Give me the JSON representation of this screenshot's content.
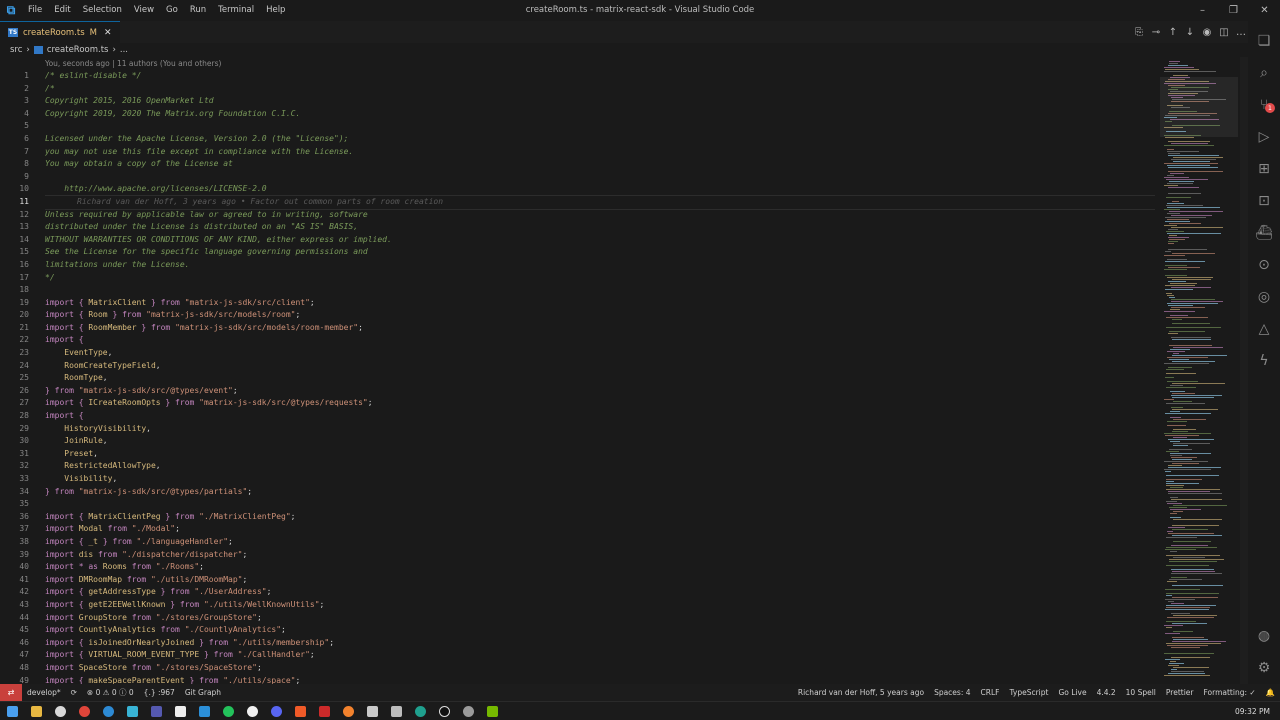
{
  "window": {
    "title": "createRoom.ts - matrix-react-sdk - Visual Studio Code",
    "menu": [
      "File",
      "Edit",
      "Selection",
      "View",
      "Go",
      "Run",
      "Terminal",
      "Help"
    ]
  },
  "tab": {
    "name": "createRoom.ts",
    "modified_marker": "M"
  },
  "breadcrumb": {
    "folder": "src",
    "file": "createRoom.ts",
    "tail": "..."
  },
  "codelens": "You, seconds ago | 11 authors (You and others)",
  "inline_blame": "Richard van der Hoff, 3 years ago • Factor out common parts of room creation",
  "code_lines": [
    {
      "n": "1",
      "t": "c",
      "s": "/* eslint-disable */"
    },
    {
      "n": "2",
      "t": "c",
      "s": "/*"
    },
    {
      "n": "3",
      "t": "c",
      "s": "Copyright 2015, 2016 OpenMarket Ltd"
    },
    {
      "n": "4",
      "t": "c",
      "s": "Copyright 2019, 2020 The Matrix.org Foundation C.I.C."
    },
    {
      "n": "5",
      "t": "c",
      "s": ""
    },
    {
      "n": "6",
      "t": "c",
      "s": "Licensed under the Apache License, Version 2.0 (the \"License\");"
    },
    {
      "n": "7",
      "t": "c",
      "s": "you may not use this file except in compliance with the License."
    },
    {
      "n": "8",
      "t": "c",
      "s": "You may obtain a copy of the License at"
    },
    {
      "n": "9",
      "t": "c",
      "s": ""
    },
    {
      "n": "10",
      "t": "c",
      "s": "    http://www.apache.org/licenses/LICENSE-2.0"
    },
    {
      "n": "11",
      "t": "b",
      "s": ""
    },
    {
      "n": "12",
      "t": "c",
      "s": "Unless required by applicable law or agreed to in writing, software"
    },
    {
      "n": "13",
      "t": "c",
      "s": "distributed under the License is distributed on an \"AS IS\" BASIS,"
    },
    {
      "n": "14",
      "t": "c",
      "s": "WITHOUT WARRANTIES OR CONDITIONS OF ANY KIND, either express or implied."
    },
    {
      "n": "15",
      "t": "c",
      "s": "See the License for the specific language governing permissions and"
    },
    {
      "n": "16",
      "t": "c",
      "s": "limitations under the License."
    },
    {
      "n": "17",
      "t": "c",
      "s": "*/"
    },
    {
      "n": "18",
      "t": "p",
      "s": ""
    },
    {
      "n": "19",
      "t": "i",
      "a": "import { ",
      "b": "MatrixClient",
      "c": " } from ",
      "d": "\"matrix-js-sdk/src/client\"",
      "e": ";"
    },
    {
      "n": "20",
      "t": "i",
      "a": "import { ",
      "b": "Room",
      "c": " } from ",
      "d": "\"matrix-js-sdk/src/models/room\"",
      "e": ";"
    },
    {
      "n": "21",
      "t": "i",
      "a": "import { ",
      "b": "RoomMember",
      "c": " } from ",
      "d": "\"matrix-js-sdk/src/models/room-member\"",
      "e": ";"
    },
    {
      "n": "22",
      "t": "i",
      "a": "import {",
      "b": "",
      "c": "",
      "d": "",
      "e": ""
    },
    {
      "n": "23",
      "t": "i",
      "a": "    ",
      "b": "EventType",
      "c": ",",
      "d": "",
      "e": ""
    },
    {
      "n": "24",
      "t": "i",
      "a": "    ",
      "b": "RoomCreateTypeField",
      "c": ",",
      "d": "",
      "e": ""
    },
    {
      "n": "25",
      "t": "i",
      "a": "    ",
      "b": "RoomType",
      "c": ",",
      "d": "",
      "e": ""
    },
    {
      "n": "26",
      "t": "i",
      "a": "} from ",
      "b": "",
      "c": "",
      "d": "\"matrix-js-sdk/src/@types/event\"",
      "e": ";"
    },
    {
      "n": "27",
      "t": "i",
      "a": "import { ",
      "b": "ICreateRoomOpts",
      "c": " } from ",
      "d": "\"matrix-js-sdk/src/@types/requests\"",
      "e": ";"
    },
    {
      "n": "28",
      "t": "i",
      "a": "import {",
      "b": "",
      "c": "",
      "d": "",
      "e": ""
    },
    {
      "n": "29",
      "t": "i",
      "a": "    ",
      "b": "HistoryVisibility",
      "c": ",",
      "d": "",
      "e": ""
    },
    {
      "n": "30",
      "t": "i",
      "a": "    ",
      "b": "JoinRule",
      "c": ",",
      "d": "",
      "e": ""
    },
    {
      "n": "31",
      "t": "i",
      "a": "    ",
      "b": "Preset",
      "c": ",",
      "d": "",
      "e": ""
    },
    {
      "n": "32",
      "t": "i",
      "a": "    ",
      "b": "RestrictedAllowType",
      "c": ",",
      "d": "",
      "e": ""
    },
    {
      "n": "33",
      "t": "i",
      "a": "    ",
      "b": "Visibility",
      "c": ",",
      "d": "",
      "e": ""
    },
    {
      "n": "34",
      "t": "i",
      "a": "} from ",
      "b": "",
      "c": "",
      "d": "\"matrix-js-sdk/src/@types/partials\"",
      "e": ";"
    },
    {
      "n": "35",
      "t": "p",
      "s": ""
    },
    {
      "n": "36",
      "t": "i",
      "a": "import { ",
      "b": "MatrixClientPeg",
      "c": " } from ",
      "d": "\"./MatrixClientPeg\"",
      "e": ";"
    },
    {
      "n": "37",
      "t": "i",
      "a": "import ",
      "b": "Modal",
      "c": " from ",
      "d": "\"./Modal\"",
      "e": ";"
    },
    {
      "n": "38",
      "t": "i",
      "a": "import { ",
      "b": "_t",
      "c": " } from ",
      "d": "\"./languageHandler\"",
      "e": ";"
    },
    {
      "n": "39",
      "t": "i",
      "a": "import ",
      "b": "dis",
      "c": " from ",
      "d": "\"./dispatcher/dispatcher\"",
      "e": ";"
    },
    {
      "n": "40",
      "t": "i",
      "a": "import * as ",
      "b": "Rooms",
      "c": " from ",
      "d": "\"./Rooms\"",
      "e": ";"
    },
    {
      "n": "41",
      "t": "i",
      "a": "import ",
      "b": "DMRoomMap",
      "c": " from ",
      "d": "\"./utils/DMRoomMap\"",
      "e": ";"
    },
    {
      "n": "42",
      "t": "i",
      "a": "import { ",
      "b": "getAddressType",
      "c": " } from ",
      "d": "\"./UserAddress\"",
      "e": ";"
    },
    {
      "n": "43",
      "t": "i",
      "a": "import { ",
      "b": "getE2EEWellKnown",
      "c": " } from ",
      "d": "\"./utils/WellKnownUtils\"",
      "e": ";"
    },
    {
      "n": "44",
      "t": "i",
      "a": "import ",
      "b": "GroupStore",
      "c": " from ",
      "d": "\"./stores/GroupStore\"",
      "e": ";"
    },
    {
      "n": "45",
      "t": "i",
      "a": "import ",
      "b": "CountlyAnalytics",
      "c": " from ",
      "d": "\"./CountlyAnalytics\"",
      "e": ";"
    },
    {
      "n": "46",
      "t": "i",
      "a": "import { ",
      "b": "isJoinedOrNearlyJoined",
      "c": " } from ",
      "d": "\"./utils/membership\"",
      "e": ";"
    },
    {
      "n": "47",
      "t": "i",
      "a": "import { ",
      "b": "VIRTUAL_ROOM_EVENT_TYPE",
      "c": " } from ",
      "d": "\"./CallHandler\"",
      "e": ";"
    },
    {
      "n": "48",
      "t": "i",
      "a": "import ",
      "b": "SpaceStore",
      "c": " from ",
      "d": "\"./stores/SpaceStore\"",
      "e": ";"
    },
    {
      "n": "49",
      "t": "i",
      "a": "import { ",
      "b": "makeSpaceParentEvent",
      "c": " } from ",
      "d": "\"./utils/space\"",
      "e": ";"
    }
  ],
  "status": {
    "branch": "develop*",
    "problems": "⊗ 0 ⚠ 0 ⓘ 0",
    "cursor": "{.} :967",
    "git_graph": "Git Graph",
    "blame": "Richard van der Hoff, 5 years ago",
    "spaces": "Spaces: 4",
    "eol": "CRLF",
    "language": "TypeScript",
    "golive": "Go Live",
    "version": "4.4.2",
    "spell": "10 Spell",
    "prettier": "Prettier",
    "formatting": "Formatting: ✓"
  },
  "activity_badge": "1",
  "taskbar": {
    "clock": "09:32 PM"
  }
}
